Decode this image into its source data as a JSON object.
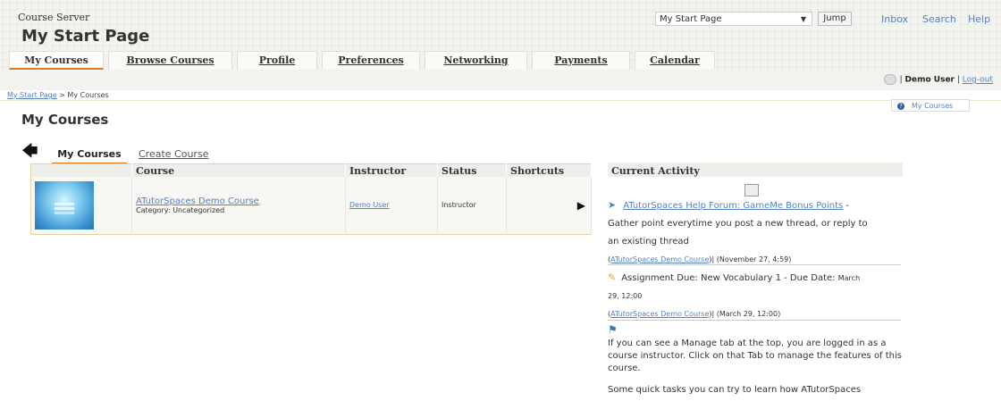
{
  "header": {
    "site_name": "Course Server",
    "page_title": "My Start Page",
    "jump_select": "My Start Page",
    "jump_button": "Jump",
    "links": [
      "Inbox",
      "Search",
      "Help"
    ]
  },
  "tabs": [
    "My Courses",
    "Browse Courses",
    "Profile",
    "Preferences",
    "Networking",
    "Payments",
    "Calendar"
  ],
  "user": {
    "name": "Demo User",
    "logout": "Log-out"
  },
  "breadcrumb": {
    "link": "My Start Page",
    "current": "> My Courses"
  },
  "help_link": "My Courses",
  "main_title": "My Courses",
  "subtabs": [
    "My Courses",
    "Create Course"
  ],
  "table": {
    "headers": [
      "Course",
      "Instructor",
      "Status",
      "Shortcuts"
    ],
    "row": {
      "course": "ATutorSpaces Demo Course",
      "category": "Category: Uncategorized",
      "instructor": "Demo User",
      "status": "Instructor"
    }
  },
  "activity": {
    "title": "Current Activity",
    "item1_link": "ATutorSpaces Help Forum: GameMe Bonus Points",
    "item1_text_a": "Gather point everytime you post a new thread, or reply to",
    "item1_text_b": "an existing thread",
    "item1_course": "ATutorSpaces Demo Course",
    "item1_date": "(November 27, 4:59)",
    "item2_text_a": "Assignment Due: New Vocabulary 1 - Due Date:",
    "item2_date_a": "March",
    "item2_date_b": "29, 12:00",
    "item2_course": "ATutorSpaces Demo Course",
    "item2_date": "(March 29, 12:00)",
    "item3_text": "If you can see a Manage tab at the top, you are logged in as a course instructor. Click on that Tab to manage the features of this course.",
    "item4_text": "Some quick tasks you can try to learn how ATutorSpaces"
  }
}
